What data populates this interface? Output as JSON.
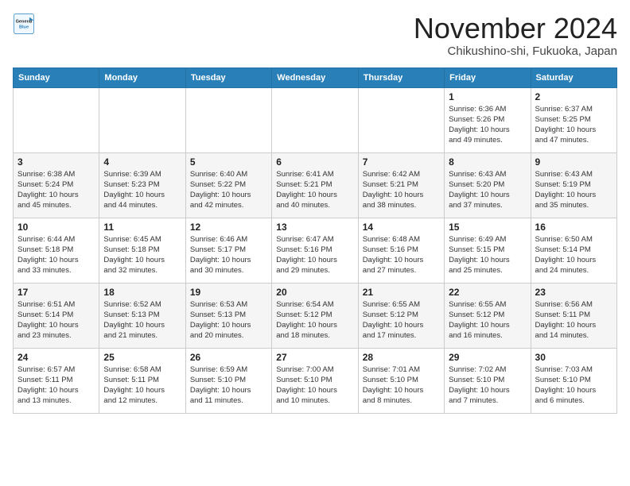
{
  "logo": {
    "line1": "General",
    "line2": "Blue"
  },
  "title": "November 2024",
  "subtitle": "Chikushino-shi, Fukuoka, Japan",
  "days_of_week": [
    "Sunday",
    "Monday",
    "Tuesday",
    "Wednesday",
    "Thursday",
    "Friday",
    "Saturday"
  ],
  "weeks": [
    [
      {
        "day": "",
        "info": ""
      },
      {
        "day": "",
        "info": ""
      },
      {
        "day": "",
        "info": ""
      },
      {
        "day": "",
        "info": ""
      },
      {
        "day": "",
        "info": ""
      },
      {
        "day": "1",
        "info": "Sunrise: 6:36 AM\nSunset: 5:26 PM\nDaylight: 10 hours\nand 49 minutes."
      },
      {
        "day": "2",
        "info": "Sunrise: 6:37 AM\nSunset: 5:25 PM\nDaylight: 10 hours\nand 47 minutes."
      }
    ],
    [
      {
        "day": "3",
        "info": "Sunrise: 6:38 AM\nSunset: 5:24 PM\nDaylight: 10 hours\nand 45 minutes."
      },
      {
        "day": "4",
        "info": "Sunrise: 6:39 AM\nSunset: 5:23 PM\nDaylight: 10 hours\nand 44 minutes."
      },
      {
        "day": "5",
        "info": "Sunrise: 6:40 AM\nSunset: 5:22 PM\nDaylight: 10 hours\nand 42 minutes."
      },
      {
        "day": "6",
        "info": "Sunrise: 6:41 AM\nSunset: 5:21 PM\nDaylight: 10 hours\nand 40 minutes."
      },
      {
        "day": "7",
        "info": "Sunrise: 6:42 AM\nSunset: 5:21 PM\nDaylight: 10 hours\nand 38 minutes."
      },
      {
        "day": "8",
        "info": "Sunrise: 6:43 AM\nSunset: 5:20 PM\nDaylight: 10 hours\nand 37 minutes."
      },
      {
        "day": "9",
        "info": "Sunrise: 6:43 AM\nSunset: 5:19 PM\nDaylight: 10 hours\nand 35 minutes."
      }
    ],
    [
      {
        "day": "10",
        "info": "Sunrise: 6:44 AM\nSunset: 5:18 PM\nDaylight: 10 hours\nand 33 minutes."
      },
      {
        "day": "11",
        "info": "Sunrise: 6:45 AM\nSunset: 5:18 PM\nDaylight: 10 hours\nand 32 minutes."
      },
      {
        "day": "12",
        "info": "Sunrise: 6:46 AM\nSunset: 5:17 PM\nDaylight: 10 hours\nand 30 minutes."
      },
      {
        "day": "13",
        "info": "Sunrise: 6:47 AM\nSunset: 5:16 PM\nDaylight: 10 hours\nand 29 minutes."
      },
      {
        "day": "14",
        "info": "Sunrise: 6:48 AM\nSunset: 5:16 PM\nDaylight: 10 hours\nand 27 minutes."
      },
      {
        "day": "15",
        "info": "Sunrise: 6:49 AM\nSunset: 5:15 PM\nDaylight: 10 hours\nand 25 minutes."
      },
      {
        "day": "16",
        "info": "Sunrise: 6:50 AM\nSunset: 5:14 PM\nDaylight: 10 hours\nand 24 minutes."
      }
    ],
    [
      {
        "day": "17",
        "info": "Sunrise: 6:51 AM\nSunset: 5:14 PM\nDaylight: 10 hours\nand 23 minutes."
      },
      {
        "day": "18",
        "info": "Sunrise: 6:52 AM\nSunset: 5:13 PM\nDaylight: 10 hours\nand 21 minutes."
      },
      {
        "day": "19",
        "info": "Sunrise: 6:53 AM\nSunset: 5:13 PM\nDaylight: 10 hours\nand 20 minutes."
      },
      {
        "day": "20",
        "info": "Sunrise: 6:54 AM\nSunset: 5:12 PM\nDaylight: 10 hours\nand 18 minutes."
      },
      {
        "day": "21",
        "info": "Sunrise: 6:55 AM\nSunset: 5:12 PM\nDaylight: 10 hours\nand 17 minutes."
      },
      {
        "day": "22",
        "info": "Sunrise: 6:55 AM\nSunset: 5:12 PM\nDaylight: 10 hours\nand 16 minutes."
      },
      {
        "day": "23",
        "info": "Sunrise: 6:56 AM\nSunset: 5:11 PM\nDaylight: 10 hours\nand 14 minutes."
      }
    ],
    [
      {
        "day": "24",
        "info": "Sunrise: 6:57 AM\nSunset: 5:11 PM\nDaylight: 10 hours\nand 13 minutes."
      },
      {
        "day": "25",
        "info": "Sunrise: 6:58 AM\nSunset: 5:11 PM\nDaylight: 10 hours\nand 12 minutes."
      },
      {
        "day": "26",
        "info": "Sunrise: 6:59 AM\nSunset: 5:10 PM\nDaylight: 10 hours\nand 11 minutes."
      },
      {
        "day": "27",
        "info": "Sunrise: 7:00 AM\nSunset: 5:10 PM\nDaylight: 10 hours\nand 10 minutes."
      },
      {
        "day": "28",
        "info": "Sunrise: 7:01 AM\nSunset: 5:10 PM\nDaylight: 10 hours\nand 8 minutes."
      },
      {
        "day": "29",
        "info": "Sunrise: 7:02 AM\nSunset: 5:10 PM\nDaylight: 10 hours\nand 7 minutes."
      },
      {
        "day": "30",
        "info": "Sunrise: 7:03 AM\nSunset: 5:10 PM\nDaylight: 10 hours\nand 6 minutes."
      }
    ]
  ]
}
